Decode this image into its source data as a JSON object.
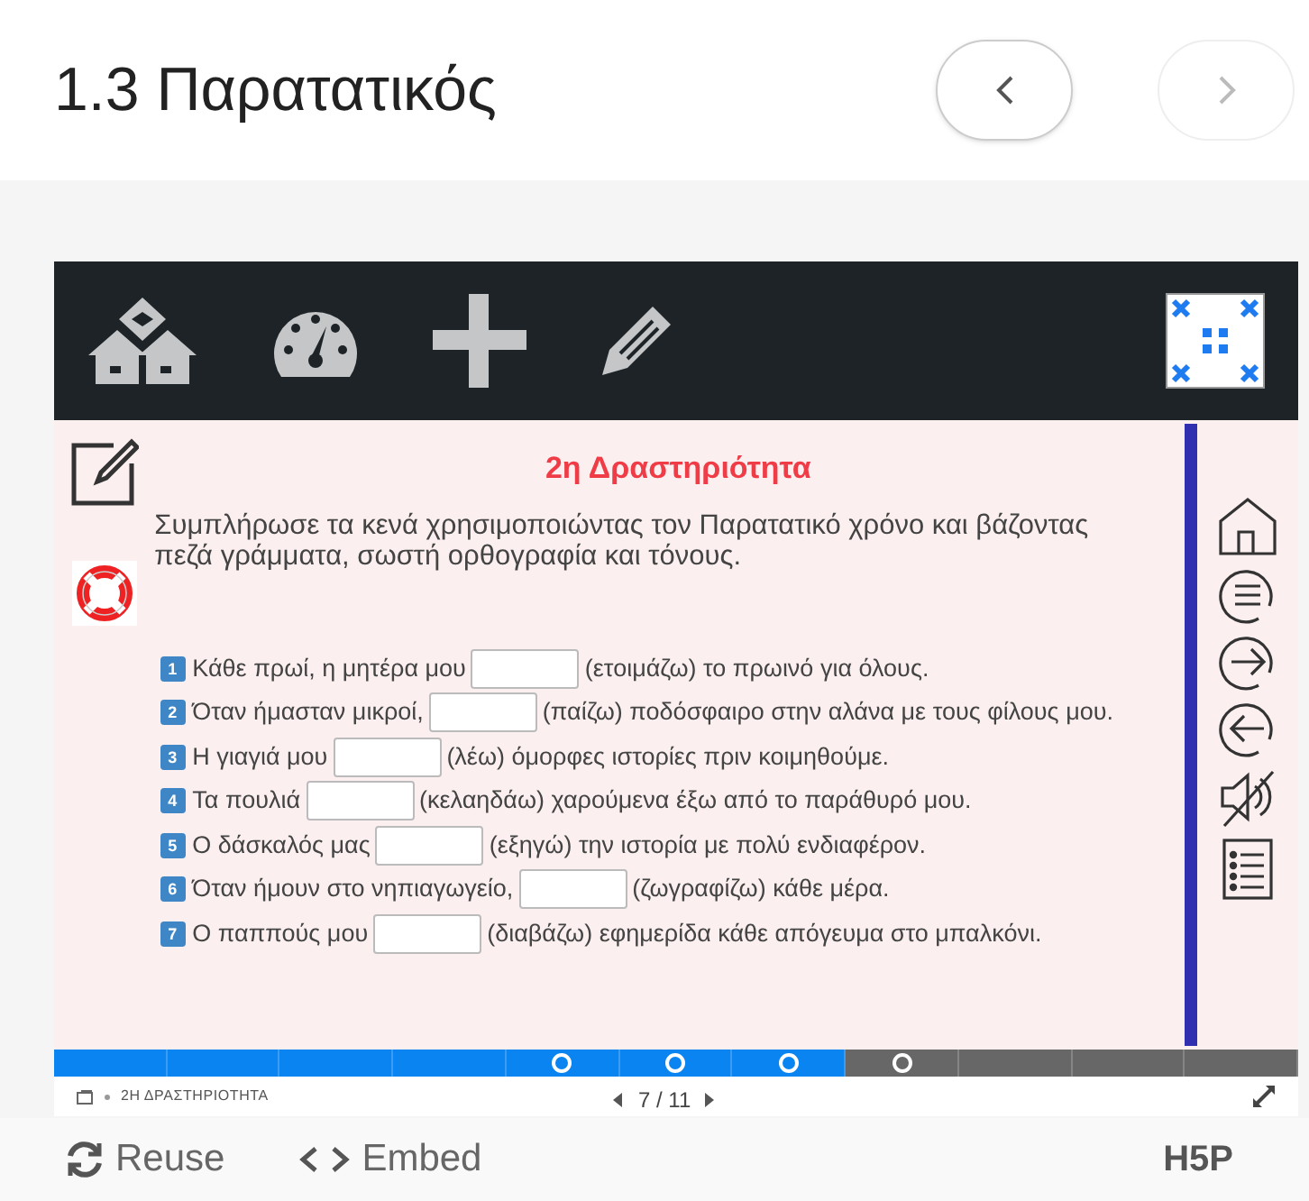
{
  "header": {
    "title": "1.3 Παρατατικός",
    "nav_buttons": [
      {
        "kind": "prev",
        "disabled": false
      },
      {
        "kind": "next",
        "disabled": true
      }
    ]
  },
  "activity": {
    "title": "2η Δραστηριότητα",
    "instruction": "Συμπλήρωσε τα κενά χρησιμοποιώντας τον Παρατατικό χρόνο και  βάζοντας πεζά γράμματα, σωστή ορθογραφία και τόνους.",
    "items": [
      {
        "number": "1",
        "before": "Κάθε πρωί, η μητέρα μου",
        "after": "(ετοιμάζω) το πρωινό για όλους."
      },
      {
        "number": "2",
        "before": "Όταν ήμασταν μικροί,",
        "after": "(παίζω) ποδόσφαιρο στην αλάνα με τους φίλους μου."
      },
      {
        "number": "3",
        "before": "Η γιαγιά μου",
        "after": "(λέω) όμορφες ιστορίες πριν κοιμηθούμε."
      },
      {
        "number": "4",
        "before": "Τα πουλιά",
        "after": "(κελαηδάω) χαρούμενα έξω από το παράθυρό μου."
      },
      {
        "number": "5",
        "before": "Ο δάσκαλός μας",
        "after": "(εξηγώ) την ιστορία με πολύ ενδιαφέρον."
      },
      {
        "number": "6",
        "before": "Όταν ήμουν στο νηπιαγωγείο,",
        "after": "(ζωγραφίζω) κάθε μέρα."
      },
      {
        "number": "7",
        "before": "Ο παππούς μου",
        "after": "(διαβάζω) εφημερίδα κάθε απόγευμα στο μπαλκόνι."
      }
    ]
  },
  "progress": [
    {
      "filled": true,
      "marker": false
    },
    {
      "filled": true,
      "marker": false
    },
    {
      "filled": true,
      "marker": false
    },
    {
      "filled": true,
      "marker": false
    },
    {
      "filled": true,
      "marker": true
    },
    {
      "filled": true,
      "marker": true
    },
    {
      "filled": true,
      "marker": true
    },
    {
      "filled": false,
      "marker": true
    },
    {
      "filled": false,
      "marker": false
    },
    {
      "filled": false,
      "marker": false
    },
    {
      "filled": false,
      "marker": false
    }
  ],
  "footer_nav": {
    "slide_title": "2Η ΔΡΑΣΤΗΡΙΟΤΗΤΑ",
    "counter": "7 / 11"
  },
  "bottom_bar": {
    "reuse": "Reuse",
    "embed": "Embed",
    "logo": "H5P"
  }
}
